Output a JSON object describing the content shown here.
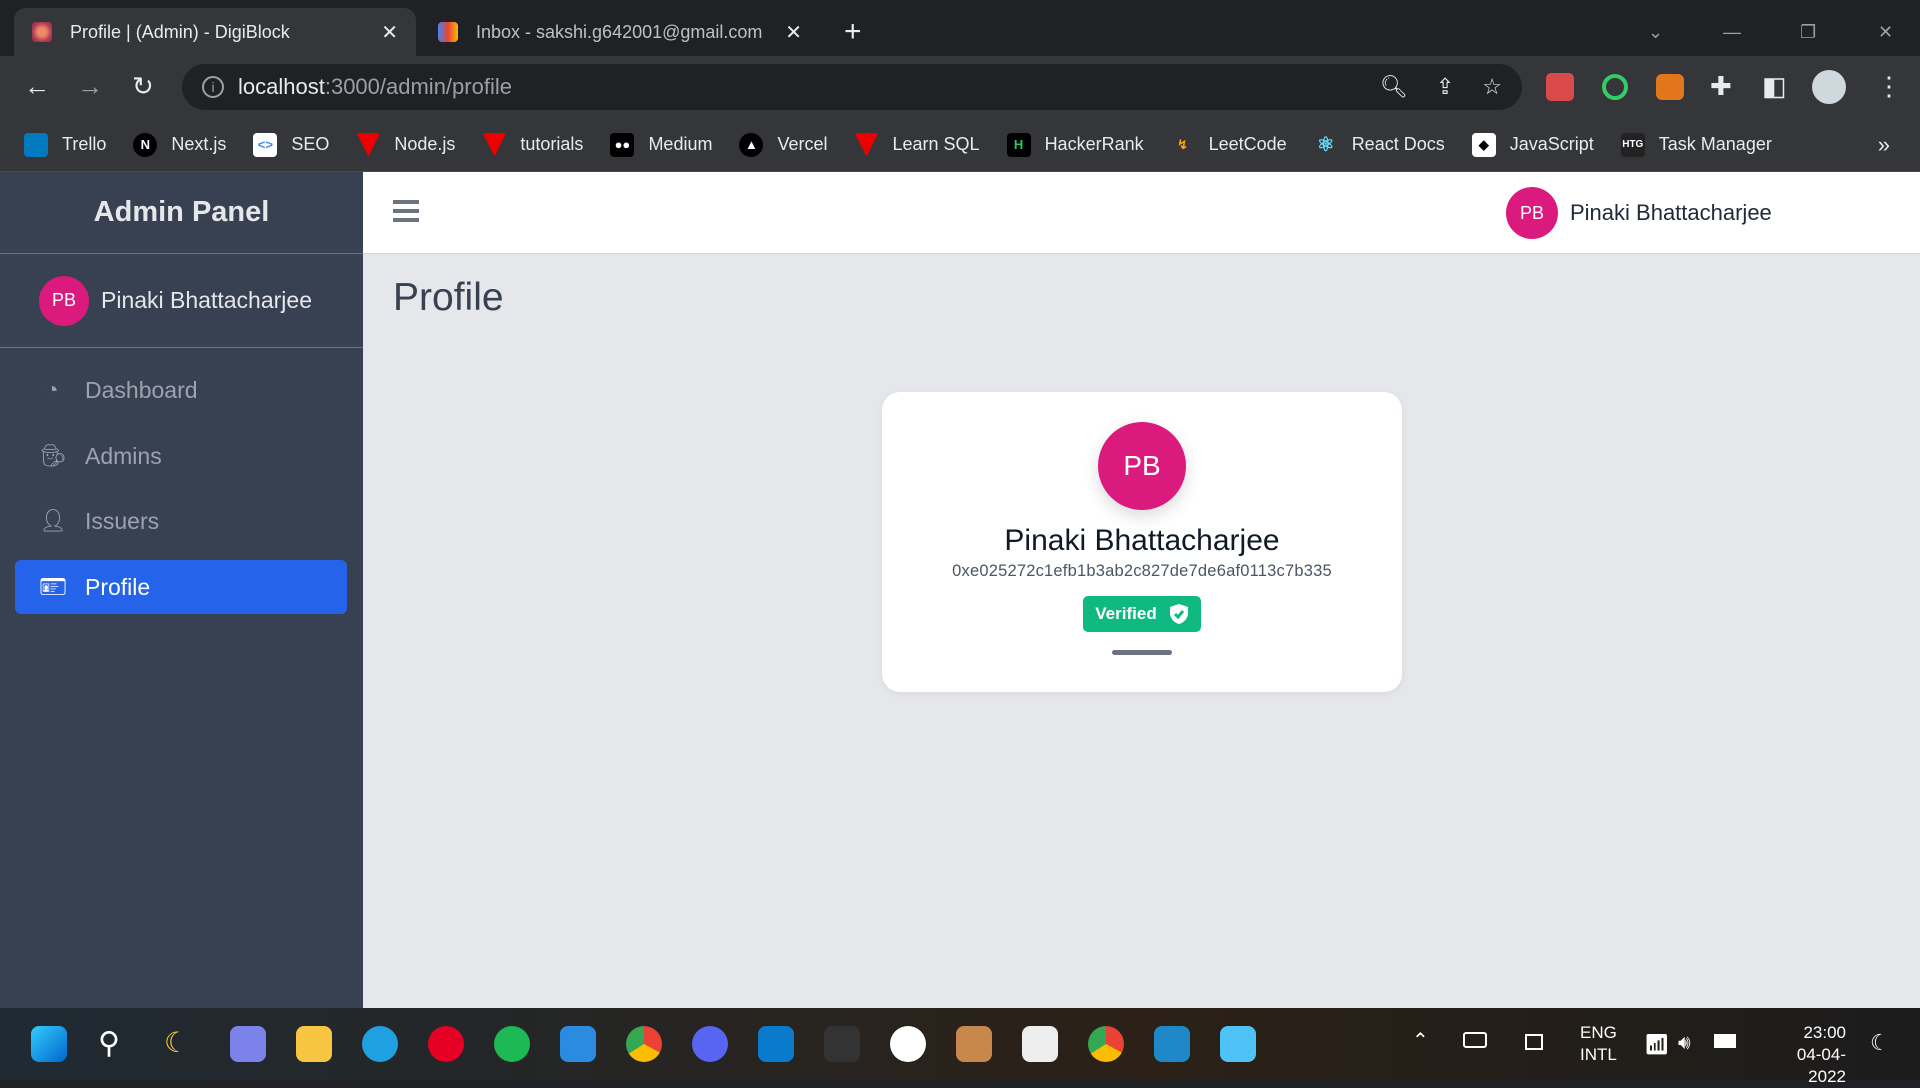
{
  "browser": {
    "tabs": [
      {
        "title": "Profile | (Admin) - DigiBlock",
        "active": true
      },
      {
        "title": "Inbox - sakshi.g642001@gmail.com",
        "active": false
      }
    ],
    "url_host": "localhost",
    "url_path": ":3000/admin/profile",
    "bookmarks": [
      "Trello",
      "Next.js",
      "SEO",
      "Node.js",
      "tutorials",
      "Medium",
      "Vercel",
      "Learn SQL",
      "HackerRank",
      "LeetCode",
      "React Docs",
      "JavaScript",
      "Task Manager"
    ],
    "more": "»"
  },
  "sidebar": {
    "title": "Admin Panel",
    "user": {
      "initials": "PB",
      "name": "Pinaki Bhattacharjee"
    },
    "items": [
      {
        "label": "Dashboard",
        "icon": "gauge-icon"
      },
      {
        "label": "Admins",
        "icon": "user-secret-icon"
      },
      {
        "label": "Issuers",
        "icon": "user-tie-icon"
      },
      {
        "label": "Profile",
        "icon": "id-badge-icon",
        "active": true
      }
    ]
  },
  "header": {
    "initials": "PB",
    "name": "Pinaki Bhattacharjee"
  },
  "page": {
    "title": "Profile"
  },
  "card": {
    "initials": "PB",
    "name": "Pinaki Bhattacharjee",
    "address": "0xe025272c1efb1b3ab2c827de7de6af0113c7b335",
    "badge": "Verified"
  },
  "colors": {
    "accent": "#2563eb",
    "avatar": "#db1a7d",
    "verified": "#10b981",
    "sidebar": "#374151"
  },
  "taskbar": {
    "lang1": "ENG",
    "lang2": "INTL",
    "time": "23:00",
    "date": "04-04-2022"
  }
}
